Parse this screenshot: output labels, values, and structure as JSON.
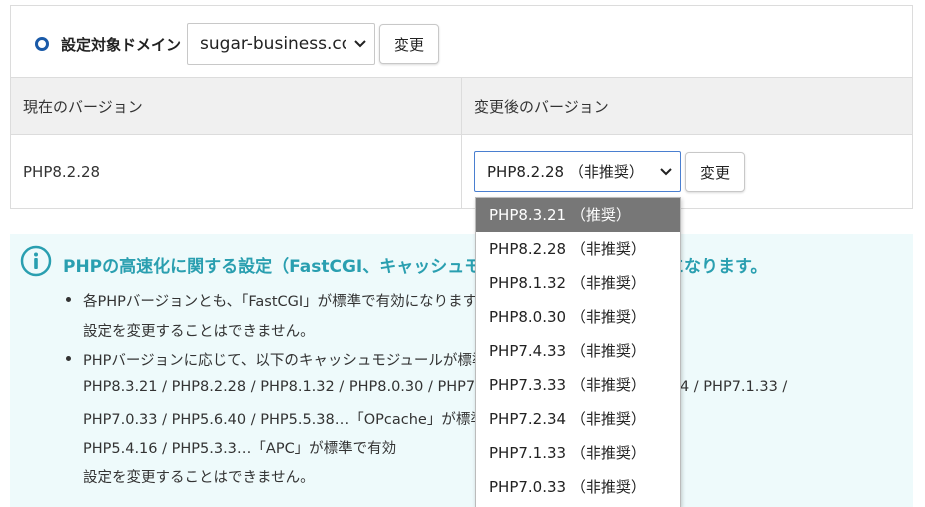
{
  "domain": {
    "label": "設定対象ドメイン",
    "selected": "sugar-business.com",
    "change_label": "変更"
  },
  "table": {
    "header_current": "現在のバージョン",
    "header_after": "変更後のバージョン",
    "current_version": "PHP8.2.28"
  },
  "php_select": {
    "selected": "PHP8.2.28 （非推奨）",
    "change_label": "変更",
    "options": [
      "PHP8.3.21 （推奨）",
      "PHP8.2.28 （非推奨）",
      "PHP8.1.32 （非推奨）",
      "PHP8.0.30 （非推奨）",
      "PHP7.4.33 （非推奨）",
      "PHP7.3.33 （非推奨）",
      "PHP7.2.34 （非推奨）",
      "PHP7.1.33 （非推奨）",
      "PHP7.0.33 （非推奨）"
    ],
    "highlighted_index": 0
  },
  "info": {
    "title": "PHPの高速化に関する設定（FastCGI、キャッシュモジュール）は標準で有効になります。",
    "lines": [
      "各PHPバージョンとも、「FastCGI」が標準で有効になります。",
      "設定を変更することはできません。",
      "PHPバージョンに応じて、以下のキャッシュモジュールが標準で有効になります。",
      "PHP8.3.21 / PHP8.2.28 / PHP8.1.32 / PHP8.0.30 / PHP7.4.33 / PHP7.3.33 / PHP7.2.34 / PHP7.1.33 /",
      "PHP7.0.33 / PHP5.6.40 / PHP5.5.38…「OPcache」が標準で有効",
      "PHP5.4.16 / PHP5.3.3…「APC」が標準で有効",
      "設定を変更することはできません。"
    ]
  },
  "colors": {
    "accent_blue": "#1a5aa8",
    "info_teal": "#2a9fb0",
    "info_bg": "#eefafb",
    "highlight": "#777777"
  }
}
